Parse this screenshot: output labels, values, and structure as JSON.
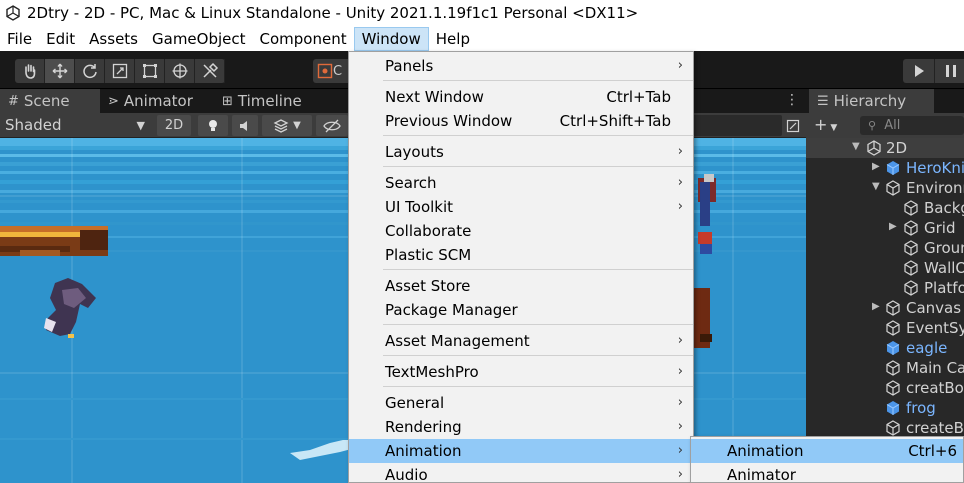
{
  "window": {
    "title": "2Dtry - 2D - PC, Mac & Linux Standalone - Unity 2021.1.19f1c1 Personal <DX11>"
  },
  "menubar": [
    "File",
    "Edit",
    "Assets",
    "GameObject",
    "Component",
    "Window",
    "Help"
  ],
  "toolbar": {
    "tools": [
      "hand-tool",
      "move-tool",
      "rotate-tool",
      "scale-tool",
      "rect-tool",
      "transform-tool",
      "custom-tool"
    ],
    "pivot_label": "C"
  },
  "scene": {
    "tabs": [
      "Scene",
      "Animator",
      "Timeline"
    ],
    "draw_mode": "Shaded",
    "mode_2d": "2D"
  },
  "hierarchy": {
    "tab": "Hierarchy",
    "search_placeholder": "All",
    "rows": [
      {
        "label": "2D"
      },
      {
        "label": "HeroKni"
      },
      {
        "label": "Environm"
      },
      {
        "label": "Backgr"
      },
      {
        "label": "Grid"
      },
      {
        "label": "Groun"
      },
      {
        "label": "WallO"
      },
      {
        "label": "Platfo"
      },
      {
        "label": "Canvas"
      },
      {
        "label": "EventSy"
      },
      {
        "label": "eagle"
      },
      {
        "label": "Main Ca"
      },
      {
        "label": "creatBo"
      },
      {
        "label": "frog"
      },
      {
        "label": "createB"
      }
    ]
  },
  "window_menu": {
    "items": [
      {
        "label": "Panels",
        "shortcut": ""
      },
      {
        "label": "Next Window",
        "shortcut": "Ctrl+Tab"
      },
      {
        "label": "Previous Window",
        "shortcut": "Ctrl+Shift+Tab"
      },
      {
        "label": "Layouts",
        "shortcut": ""
      },
      {
        "label": "Search",
        "shortcut": ""
      },
      {
        "label": "UI Toolkit",
        "shortcut": ""
      },
      {
        "label": "Collaborate",
        "shortcut": ""
      },
      {
        "label": "Plastic SCM",
        "shortcut": ""
      },
      {
        "label": "Asset Store",
        "shortcut": ""
      },
      {
        "label": "Package Manager",
        "shortcut": ""
      },
      {
        "label": "Asset Management",
        "shortcut": ""
      },
      {
        "label": "TextMeshPro",
        "shortcut": ""
      },
      {
        "label": "General",
        "shortcut": ""
      },
      {
        "label": "Rendering",
        "shortcut": ""
      },
      {
        "label": "Animation",
        "shortcut": ""
      },
      {
        "label": "Audio",
        "shortcut": ""
      }
    ],
    "submenu_arrow": "›"
  },
  "animation_submenu": {
    "items": [
      {
        "label": "Animation",
        "shortcut": "Ctrl+6"
      },
      {
        "label": "Animator",
        "shortcut": ""
      }
    ]
  },
  "colors": {
    "menu_highlight": "#91c9f7",
    "active_menu": "#cce4f7",
    "editor_dark": "#191919",
    "scene_water": "#2f8fc7",
    "prefab_blue": "#7bb6ff"
  }
}
